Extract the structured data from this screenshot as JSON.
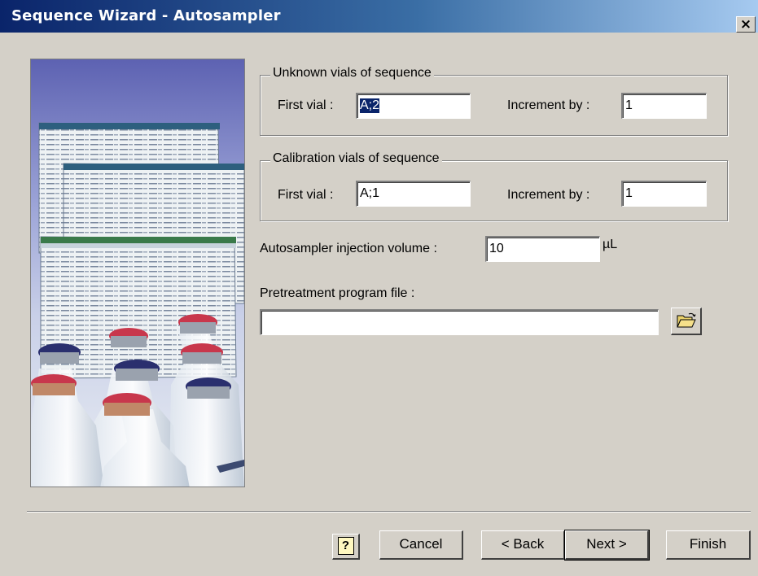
{
  "window": {
    "title": "Sequence Wizard - Autosampler",
    "close_label": "×"
  },
  "unknown_group": {
    "legend": "Unknown vials of sequence",
    "first_vial_label": "First vial :",
    "first_vial_value": "A;2",
    "increment_label": "Increment by :",
    "increment_value": "1"
  },
  "calibration_group": {
    "legend": "Calibration vials of sequence",
    "first_vial_label": "First vial :",
    "first_vial_value": "A;1",
    "increment_label": "Increment by :",
    "increment_value": "1"
  },
  "injection": {
    "label": "Autosampler injection volume :",
    "value": "10",
    "unit": "µL"
  },
  "pretreatment": {
    "label": "Pretreatment program file :",
    "value": ""
  },
  "buttons": {
    "help": "?",
    "cancel": "Cancel",
    "back": "< Back",
    "next": "Next >",
    "finish": "Finish"
  },
  "icons": {
    "browse": "open-folder-icon",
    "help": "help-icon",
    "close": "close-icon"
  },
  "colors": {
    "title_start": "#0a246a",
    "title_end": "#a6caf0",
    "face": "#d4d0c8",
    "selection": "#0a246a"
  }
}
